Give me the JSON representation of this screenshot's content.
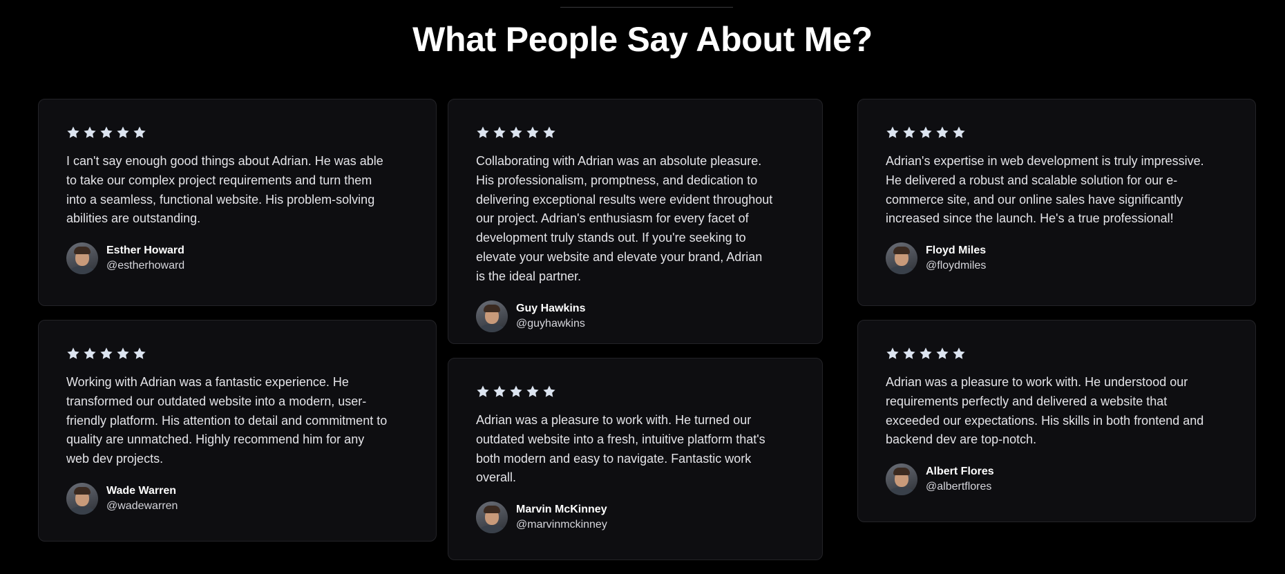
{
  "section": {
    "title": "What People Say About Me?"
  },
  "colors": {
    "background": "#000000",
    "card": "#0e0e11",
    "star": "#dce4f0"
  },
  "rating": {
    "stars": 5,
    "icon": "star-icon"
  },
  "testimonials": [
    {
      "quote": "I can't say enough good things about Adrian. He was able to take our complex project requirements and turn them into a seamless, functional website. His problem-solving abilities are outstanding.",
      "name": "Esther Howard",
      "handle": "@estherhoward"
    },
    {
      "quote": "Collaborating with Adrian was an absolute pleasure. His professionalism, promptness, and dedication to delivering exceptional results were evident throughout our project. Adrian's enthusiasm for every facet of development truly stands out. If you're seeking to elevate your website and elevate your brand, Adrian is the ideal partner.",
      "name": "Guy Hawkins",
      "handle": "@guyhawkins"
    },
    {
      "quote": "Adrian's expertise in web development is truly impressive. He delivered a robust and scalable solution for our e-commerce site, and our online sales have significantly increased since the launch. He's a true professional!",
      "name": "Floyd Miles",
      "handle": "@floydmiles"
    },
    {
      "quote": "Working with Adrian was a fantastic experience. He transformed our outdated website into a modern, user-friendly platform. His attention to detail and commitment to quality are unmatched. Highly recommend him for any web dev projects.",
      "name": "Wade Warren",
      "handle": "@wadewarren"
    },
    {
      "quote": "Adrian was a pleasure to work with. He turned our outdated website into a fresh, intuitive platform that's both modern and easy to navigate. Fantastic work overall.",
      "name": "Marvin McKinney",
      "handle": "@marvinmckinney"
    },
    {
      "quote": "Adrian was a pleasure to work with. He understood our requirements perfectly and delivered a website that exceeded our expectations. His skills in both frontend and backend dev are top-notch.",
      "name": "Albert Flores",
      "handle": "@albertflores"
    }
  ]
}
